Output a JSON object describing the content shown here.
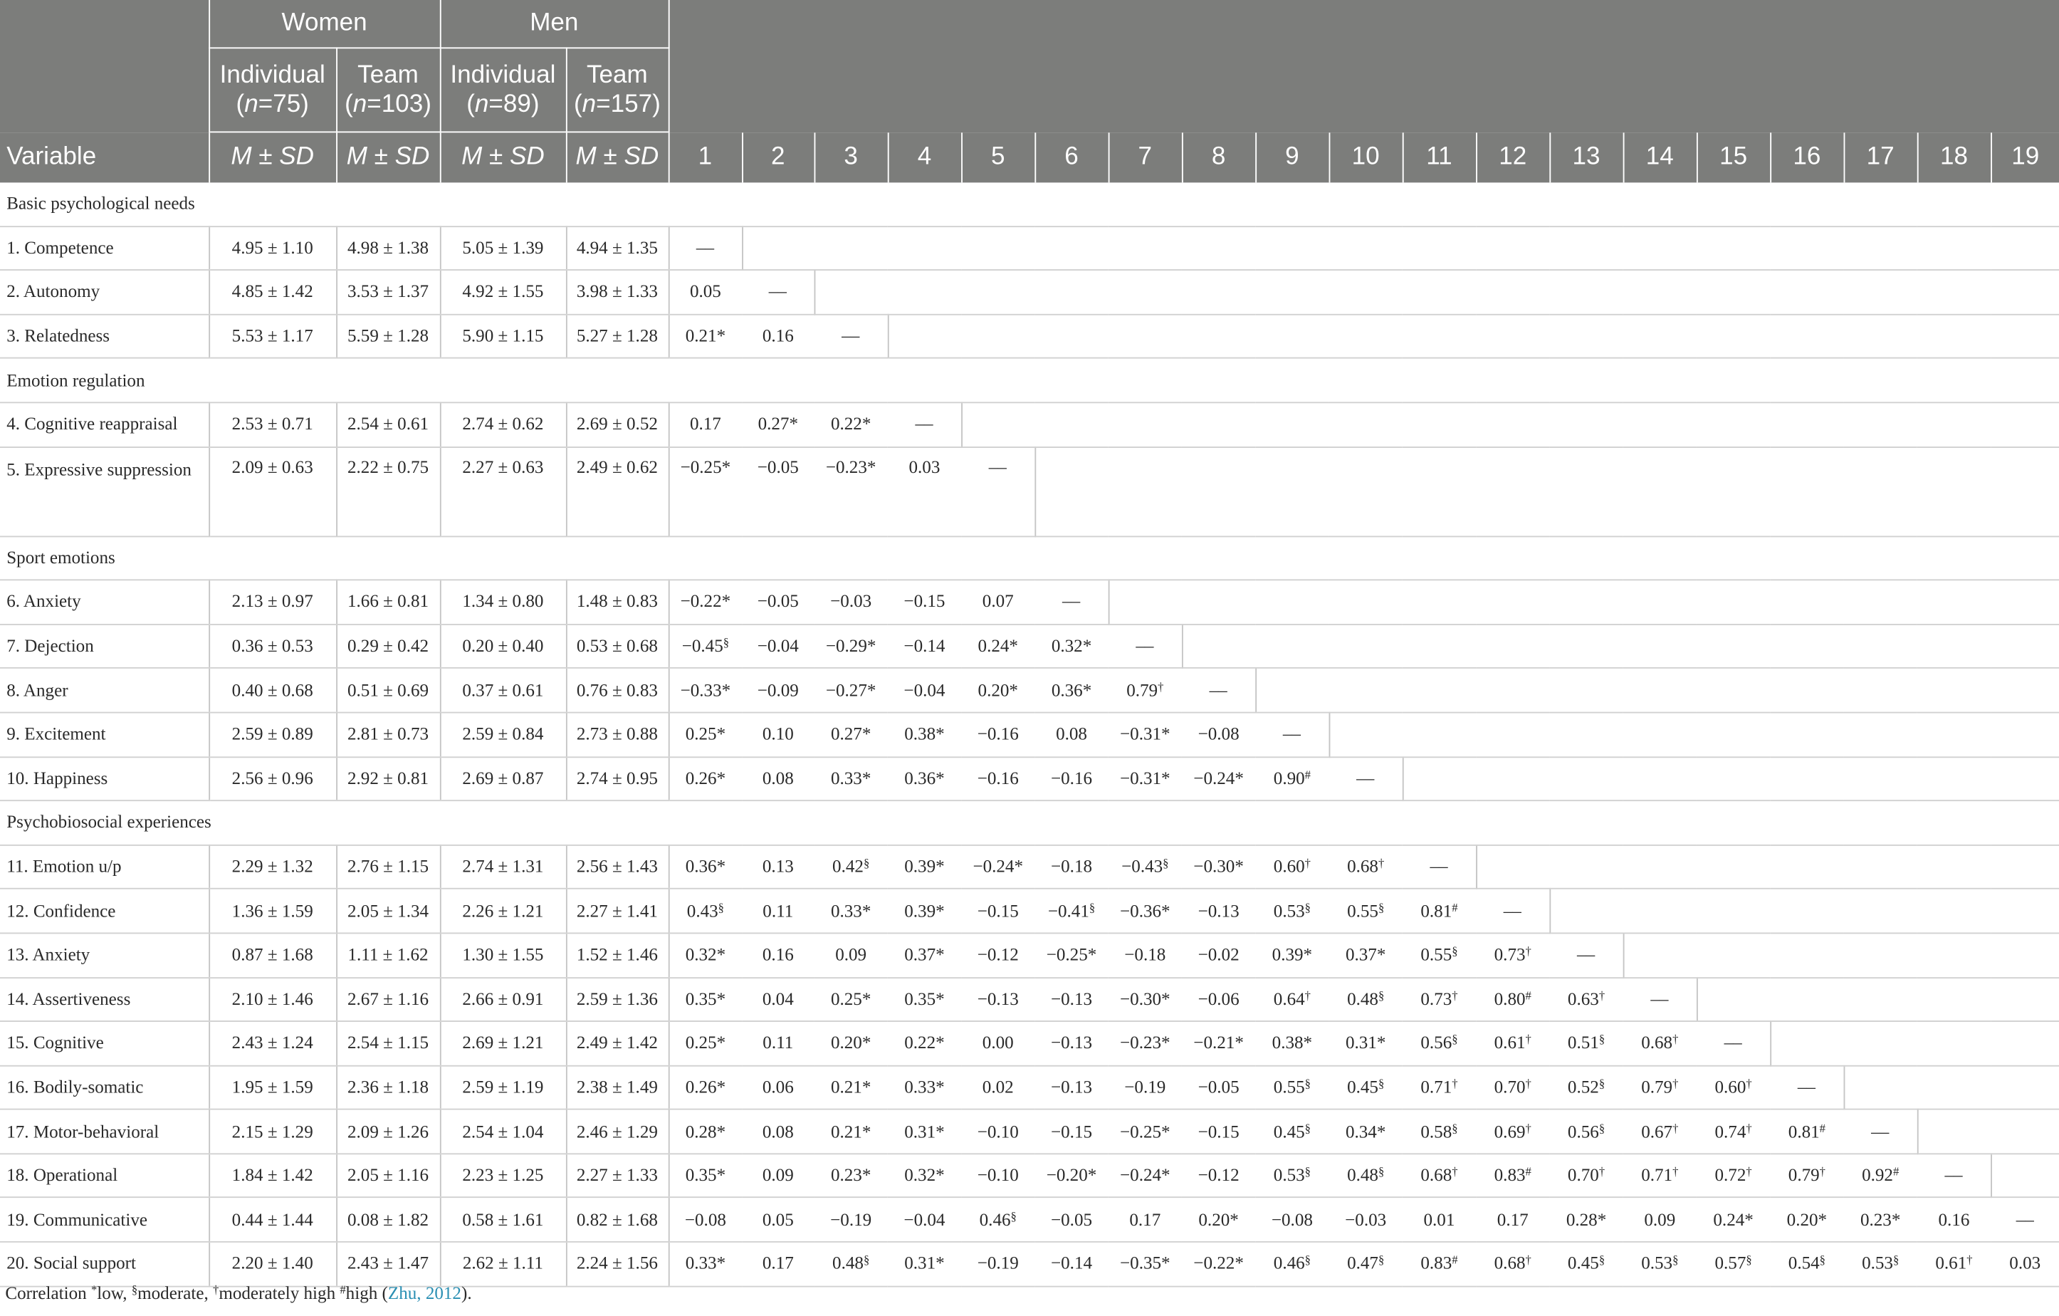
{
  "header": {
    "groups": [
      "Women",
      "Men"
    ],
    "subgroups": [
      {
        "name": "Individual",
        "n_prefix": "(",
        "n_var": "n",
        "n_val": "=75)"
      },
      {
        "name": "Team",
        "n_prefix": "(",
        "n_var": "n",
        "n_val": "=103)"
      },
      {
        "name": "Individual",
        "n_prefix": "(",
        "n_var": "n",
        "n_val": "=89)"
      },
      {
        "name": "Team",
        "n_prefix": "(",
        "n_var": "n",
        "n_val": "=157)"
      }
    ],
    "variable_label": "Variable",
    "stat_M": "M",
    "stat_pm": " ± ",
    "stat_SD": "SD",
    "column_numbers": [
      "1",
      "2",
      "3",
      "4",
      "5",
      "6",
      "7",
      "8",
      "9",
      "10",
      "11",
      "12",
      "13",
      "14",
      "15",
      "16",
      "17",
      "18",
      "19"
    ]
  },
  "sections": [
    {
      "title": "Basic psychological needs",
      "rows": [
        {
          "label": "1. Competence",
          "stats": [
            "4.95 ± 1.10",
            "4.98 ± 1.38",
            "5.05 ± 1.39",
            "4.94 ± 1.35"
          ],
          "corr": [
            "–‒"
          ]
        },
        {
          "label": "2. Autonomy",
          "stats": [
            "4.85 ± 1.42",
            "3.53 ± 1.37",
            "4.92 ± 1.55",
            "3.98 ± 1.33"
          ],
          "corr": [
            "0.05",
            "–‒"
          ]
        },
        {
          "label": "3. Relatedness",
          "stats": [
            "5.53 ± 1.17",
            "5.59 ± 1.28",
            "5.90 ± 1.15",
            "5.27 ± 1.28"
          ],
          "corr": [
            "0.21*",
            "0.16",
            "–‒"
          ]
        }
      ]
    },
    {
      "title": "Emotion regulation",
      "rows": [
        {
          "label": "4. Cognitive reappraisal",
          "stats": [
            "2.53 ± 0.71",
            "2.54 ± 0.61",
            "2.74 ± 0.62",
            "2.69 ± 0.52"
          ],
          "corr": [
            "0.17",
            "0.27*",
            "0.22*",
            "–‒"
          ]
        },
        {
          "label": "5. Expressive suppression",
          "tall": true,
          "stats": [
            "2.09 ± 0.63",
            "2.22 ± 0.75",
            "2.27 ± 0.63",
            "2.49 ± 0.62"
          ],
          "corr": [
            "−0.25*",
            "−0.05",
            "−0.23*",
            "0.03",
            "–‒"
          ]
        }
      ]
    },
    {
      "title": "Sport emotions",
      "rows": [
        {
          "label": "6. Anxiety",
          "stats": [
            "2.13 ± 0.97",
            "1.66 ± 0.81",
            "1.34 ± 0.80",
            "1.48 ± 0.83"
          ],
          "corr": [
            "−0.22*",
            "−0.05",
            "−0.03",
            "−0.15",
            "0.07",
            "–‒"
          ]
        },
        {
          "label": "7. Dejection",
          "stats": [
            "0.36 ± 0.53",
            "0.29 ± 0.42",
            "0.20 ± 0.40",
            "0.53 ± 0.68"
          ],
          "corr": [
            "−0.45§",
            "−0.04",
            "−0.29*",
            "−0.14",
            "0.24*",
            "0.32*",
            "–‒"
          ]
        },
        {
          "label": "8. Anger",
          "stats": [
            "0.40 ± 0.68",
            "0.51 ± 0.69",
            "0.37 ± 0.61",
            "0.76 ± 0.83"
          ],
          "corr": [
            "−0.33*",
            "−0.09",
            "−0.27*",
            "−0.04",
            "0.20*",
            "0.36*",
            "0.79†",
            "–‒"
          ]
        },
        {
          "label": "9. Excitement",
          "stats": [
            "2.59 ± 0.89",
            "2.81 ± 0.73",
            "2.59 ± 0.84",
            "2.73 ± 0.88"
          ],
          "corr": [
            "0.25*",
            "0.10",
            "0.27*",
            "0.38*",
            "−0.16",
            "0.08",
            "−0.31*",
            "−0.08",
            "–‒"
          ]
        },
        {
          "label": "10. Happiness",
          "stats": [
            "2.56 ± 0.96",
            "2.92 ± 0.81",
            "2.69 ± 0.87",
            "2.74 ± 0.95"
          ],
          "corr": [
            "0.26*",
            "0.08",
            "0.33*",
            "0.36*",
            "−0.16",
            "−0.16",
            "−0.31*",
            "−0.24*",
            "0.90#",
            "–‒"
          ]
        }
      ]
    },
    {
      "title": "Psychobiosocial experiences",
      "rows": [
        {
          "label": "11. Emotion u/p",
          "stats": [
            "2.29 ± 1.32",
            "2.76 ± 1.15",
            "2.74 ± 1.31",
            "2.56 ± 1.43"
          ],
          "corr": [
            "0.36*",
            "0.13",
            "0.42§",
            "0.39*",
            "−0.24*",
            "−0.18",
            "−0.43§",
            "−0.30*",
            "0.60†",
            "0.68†",
            "–‒"
          ]
        },
        {
          "label": "12. Confidence",
          "stats": [
            "1.36 ± 1.59",
            "2.05 ± 1.34",
            "2.26 ± 1.21",
            "2.27 ± 1.41"
          ],
          "corr": [
            "0.43§",
            "0.11",
            "0.33*",
            "0.39*",
            "−0.15",
            "−0.41§",
            "−0.36*",
            "−0.13",
            "0.53§",
            "0.55§",
            "0.81#",
            "–‒"
          ]
        },
        {
          "label": "13. Anxiety",
          "stats": [
            "0.87 ± 1.68",
            "1.11 ± 1.62",
            "1.30 ± 1.55",
            "1.52 ± 1.46"
          ],
          "corr": [
            "0.32*",
            "0.16",
            "0.09",
            "0.37*",
            "−0.12",
            "−0.25*",
            "−0.18",
            "−0.02",
            "0.39*",
            "0.37*",
            "0.55§",
            "0.73†",
            "–‒"
          ]
        },
        {
          "label": "14. Assertiveness",
          "stats": [
            "2.10 ± 1.46",
            "2.67 ± 1.16",
            "2.66 ± 0.91",
            "2.59 ± 1.36"
          ],
          "corr": [
            "0.35*",
            "0.04",
            "0.25*",
            "0.35*",
            "−0.13",
            "−0.13",
            "−0.30*",
            "−0.06",
            "0.64†",
            "0.48§",
            "0.73†",
            "0.80#",
            "0.63†",
            "–‒"
          ]
        },
        {
          "label": "15. Cognitive",
          "stats": [
            "2.43 ± 1.24",
            "2.54 ± 1.15",
            "2.69 ± 1.21",
            "2.49 ± 1.42"
          ],
          "corr": [
            "0.25*",
            "0.11",
            "0.20*",
            "0.22*",
            "0.00",
            "−0.13",
            "−0.23*",
            "−0.21*",
            "0.38*",
            "0.31*",
            "0.56§",
            "0.61†",
            "0.51§",
            "0.68†",
            "–‒"
          ]
        },
        {
          "label": "16. Bodily-somatic",
          "stats": [
            "1.95 ± 1.59",
            "2.36 ± 1.18",
            "2.59 ± 1.19",
            "2.38 ± 1.49"
          ],
          "corr": [
            "0.26*",
            "0.06",
            "0.21*",
            "0.33*",
            "0.02",
            "−0.13",
            "−0.19",
            "−0.05",
            "0.55§",
            "0.45§",
            "0.71†",
            "0.70†",
            "0.52§",
            "0.79†",
            "0.60†",
            "–‒"
          ]
        },
        {
          "label": "17. Motor-behavioral",
          "stats": [
            "2.15 ± 1.29",
            "2.09 ± 1.26",
            "2.54 ± 1.04",
            "2.46 ± 1.29"
          ],
          "corr": [
            "0.28*",
            "0.08",
            "0.21*",
            "0.31*",
            "−0.10",
            "−0.15",
            "−0.25*",
            "−0.15",
            "0.45§",
            "0.34*",
            "0.58§",
            "0.69†",
            "0.56§",
            "0.67†",
            "0.74†",
            "0.81#",
            "–‒"
          ]
        },
        {
          "label": "18. Operational",
          "stats": [
            "1.84 ± 1.42",
            "2.05 ± 1.16",
            "2.23 ± 1.25",
            "2.27 ± 1.33"
          ],
          "corr": [
            "0.35*",
            "0.09",
            "0.23*",
            "0.32*",
            "−0.10",
            "−0.20*",
            "−0.24*",
            "−0.12",
            "0.53§",
            "0.48§",
            "0.68†",
            "0.83#",
            "0.70†",
            "0.71†",
            "0.72†",
            "0.79†",
            "0.92#",
            "–‒"
          ]
        },
        {
          "label": "19. Communicative",
          "stats": [
            "0.44 ± 1.44",
            "0.08 ± 1.82",
            "0.58 ± 1.61",
            "0.82 ± 1.68"
          ],
          "corr": [
            "−0.08",
            "0.05",
            "−0.19",
            "−0.04",
            "0.46§",
            "−0.05",
            "0.17",
            "0.20*",
            "−0.08",
            "−0.03",
            "0.01",
            "0.17",
            "0.28*",
            "0.09",
            "0.24*",
            "0.20*",
            "0.23*",
            "0.16",
            "–‒"
          ]
        },
        {
          "label": "20. Social support",
          "stats": [
            "2.20 ± 1.40",
            "2.43 ± 1.47",
            "2.62 ± 1.11",
            "2.24 ± 1.56"
          ],
          "corr": [
            "0.33*",
            "0.17",
            "0.48§",
            "0.31*",
            "−0.19",
            "−0.14",
            "−0.35*",
            "−0.22*",
            "0.46§",
            "0.47§",
            "0.83#",
            "0.68†",
            "0.45§",
            "0.53§",
            "0.57§",
            "0.54§",
            "0.53§",
            "0.61†",
            "0.03"
          ]
        }
      ]
    }
  ],
  "note": {
    "text": "Correlation *low, §moderate, †moderately high #high (",
    "citation": "Zhu, 2012",
    "tail": ")."
  },
  "colors": {
    "header_bg": "#7c7d7b",
    "link": "#2a8fb3"
  }
}
